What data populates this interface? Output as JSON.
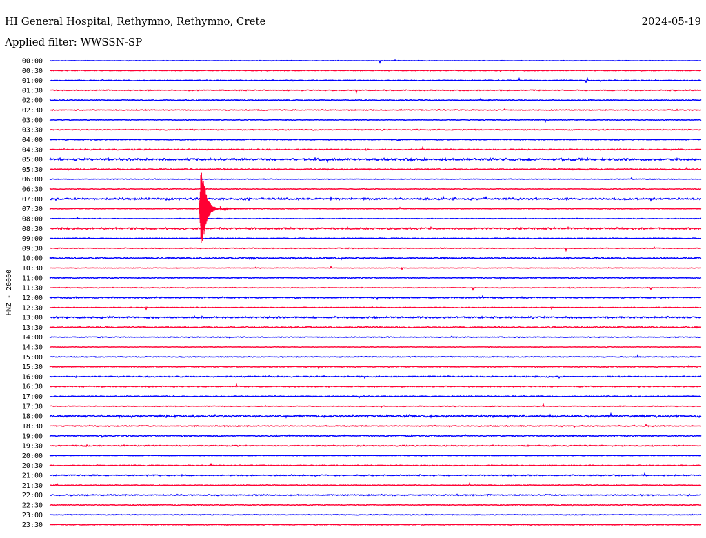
{
  "header": {
    "station": "HI General Hospital, Rethymno, Rethymno, Crete",
    "date": "2024-05-19",
    "filter": "Applied filter: WWSSN-SP"
  },
  "colors": {
    "background": "#ffffff",
    "trace_even": "#0000ff",
    "trace_odd": "#ff0033",
    "text": "#000000"
  },
  "chart_data": {
    "type": "line",
    "title": "HI General Hospital, Rethymno, Rethymno, Crete",
    "ylabel": "HNZ - 20000",
    "row_labels": [
      "00:00",
      "00:30",
      "01:00",
      "01:30",
      "02:00",
      "02:30",
      "03:00",
      "03:30",
      "04:00",
      "04:30",
      "05:00",
      "05:30",
      "06:00",
      "06:30",
      "07:00",
      "07:30",
      "08:00",
      "08:30",
      "09:00",
      "09:30",
      "10:00",
      "10:30",
      "11:00",
      "11:30",
      "12:00",
      "12:30",
      "13:00",
      "13:30",
      "14:00",
      "14:30",
      "15:00",
      "15:30",
      "16:00",
      "16:30",
      "17:00",
      "17:30",
      "18:00",
      "18:30",
      "19:00",
      "19:30",
      "20:00",
      "20:30",
      "21:00",
      "21:30",
      "22:00",
      "22:30",
      "23:00",
      "23:30"
    ],
    "minutes_per_row": 30,
    "series_colors": [
      "#0000ff",
      "#ff0033"
    ],
    "legend": "none",
    "grid": false,
    "events": [
      {
        "row": 15,
        "minute": 6.9,
        "amplitude": "large",
        "color": "#ff0033"
      }
    ]
  }
}
